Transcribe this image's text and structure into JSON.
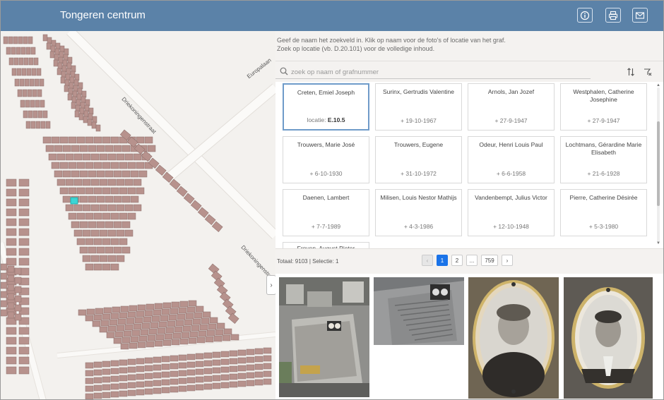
{
  "app": {
    "title": "Tongeren centrum"
  },
  "header_buttons": [
    {
      "icon": "info-icon"
    },
    {
      "icon": "print-icon"
    },
    {
      "icon": "mail-icon"
    }
  ],
  "map": {
    "streets": [
      "Europalaan",
      "Driekoningenstraat",
      "Driekoningenstraat"
    ]
  },
  "instructions": {
    "line1": "Geef de naam het zoekveld in. Klik op naam voor de foto's of locatie van het graf.",
    "line2": "Zoek op locatie (vb. D.20.101) voor de volledige inhoud."
  },
  "search": {
    "placeholder": "zoek op naam of grafnummer",
    "value": ""
  },
  "results": [
    {
      "name": "Creten, Emiel Joseph",
      "sub_prefix": "locatie:",
      "sub_value": "E.10.5",
      "selected": true
    },
    {
      "name": "Surinx, Gertrudis Valentine",
      "sub": "+ 19-10-1967"
    },
    {
      "name": "Arnols, Jan Jozef",
      "sub": "+ 27-9-1947"
    },
    {
      "name": "Westphalen, Catherine Josephine",
      "sub": "+ 27-9-1947"
    },
    {
      "name": "Trouwers, Marie José",
      "sub": "+ 6-10-1930"
    },
    {
      "name": "Trouwers, Eugene",
      "sub": "+ 31-10-1972"
    },
    {
      "name": "Odeur, Henri Louis Paul",
      "sub": "+ 6-6-1958"
    },
    {
      "name": "Lochtmans, Gérardine Marie Elisabeth",
      "sub": "+ 21-6-1928"
    },
    {
      "name": "Daenen, Lambert",
      "sub": "+ 7-7-1989"
    },
    {
      "name": "Milisen, Louis Nestor Mathijs",
      "sub": "+ 4-3-1986"
    },
    {
      "name": "Vandenbempt, Julius Victor",
      "sub": "+ 12-10-1948"
    },
    {
      "name": "Pierre, Catherine Désirée",
      "sub": "+ 5-3-1980"
    },
    {
      "name": "Froyen, August Pieter",
      "sub": ""
    }
  ],
  "pager": {
    "totals": "Totaal: 9103 | Selectie: 1",
    "prev": "‹",
    "pages": [
      "1",
      "2",
      "...",
      "759"
    ],
    "next": "›",
    "current": "1"
  },
  "photos": [
    {
      "kind": "grave-stone"
    },
    {
      "kind": "grave-slab"
    },
    {
      "kind": "portrait-woman"
    },
    {
      "kind": "portrait-man"
    }
  ],
  "colors": {
    "header": "#5b82a8",
    "plot": "#b7928d",
    "highlight": "#3bd5d5",
    "accent": "#1a73e8"
  }
}
